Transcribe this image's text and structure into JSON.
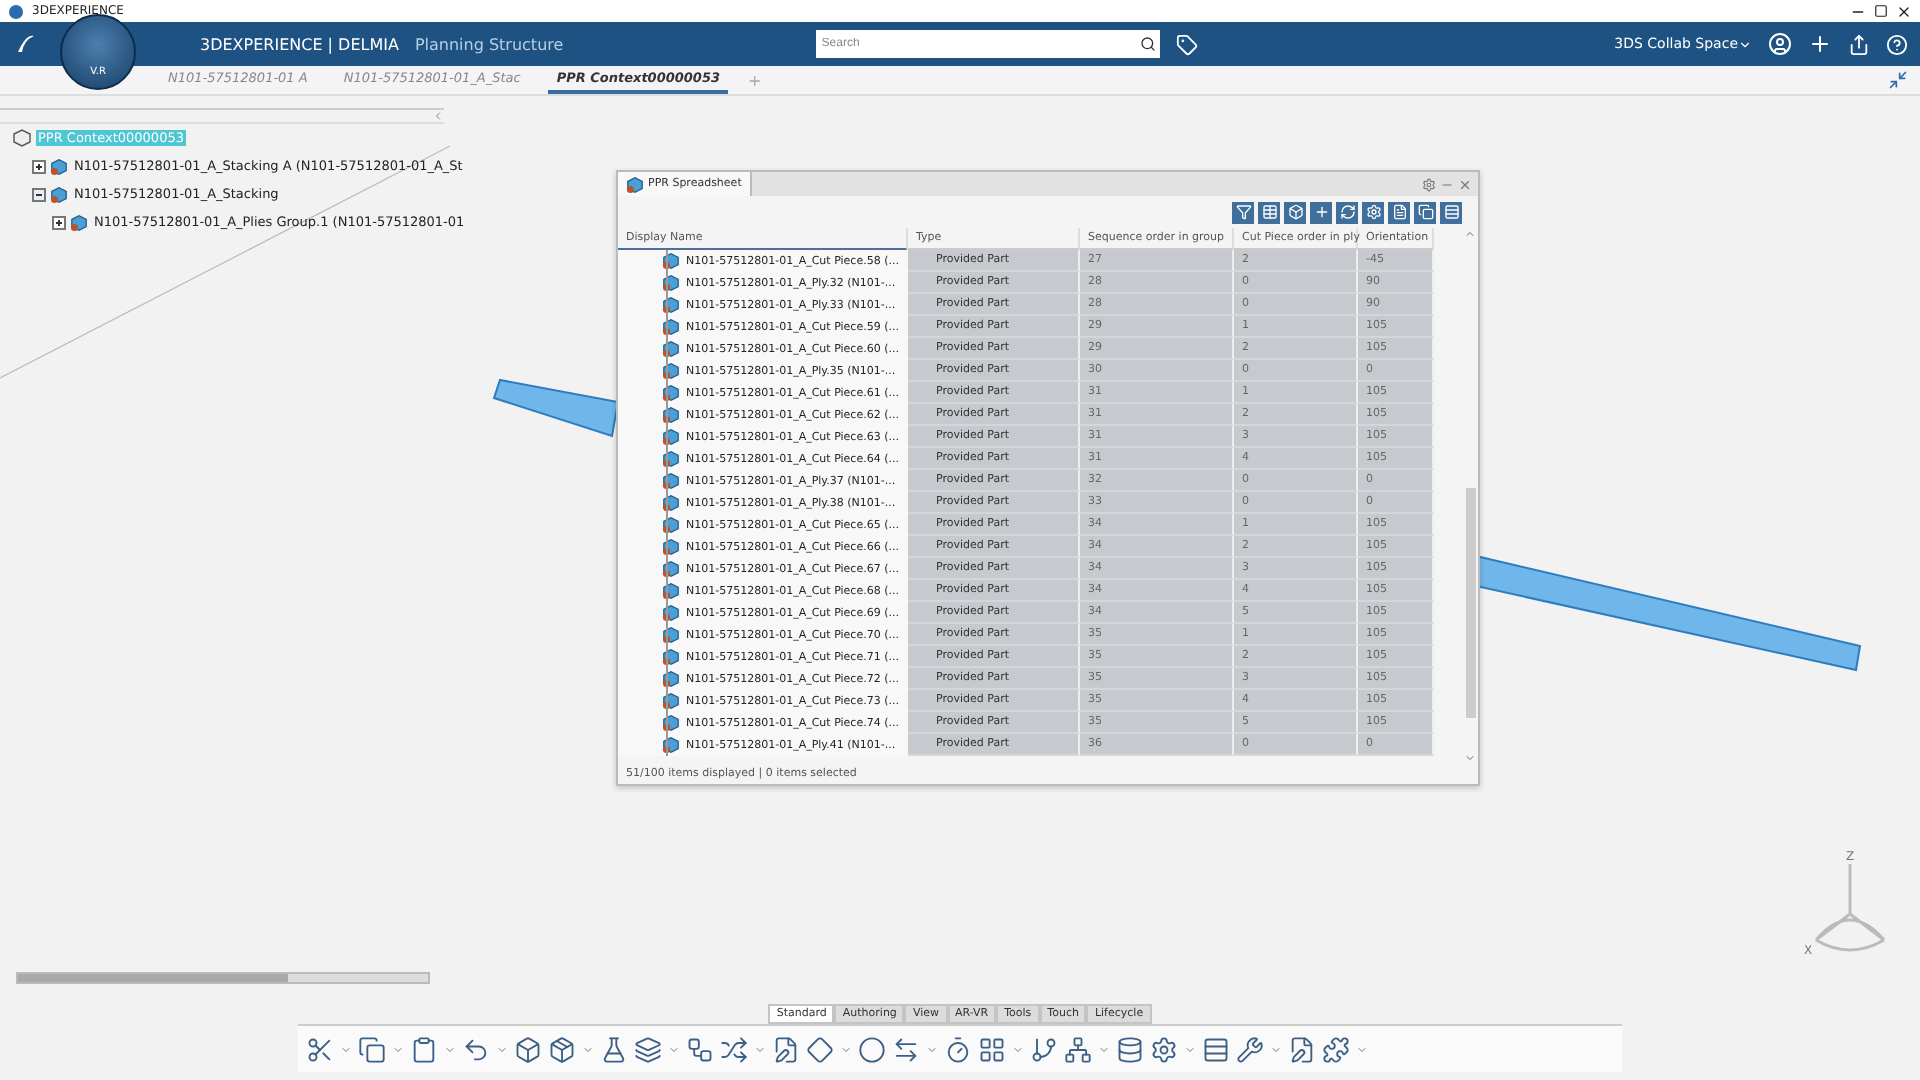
{
  "window": {
    "title": "3DEXPERIENCE"
  },
  "header": {
    "brand": "3DEXPERIENCE | DELMIA",
    "app": "Planning Structure",
    "compass_label": "V.R",
    "search": {
      "placeholder": "Search"
    },
    "space": "3DS Collab Space"
  },
  "doc_tabs": [
    {
      "label": "N101-57512801-01 A",
      "selected": false
    },
    {
      "label": "N101-57512801-01_A_Stac",
      "selected": false
    },
    {
      "label": "PPR Context00000053",
      "selected": true
    }
  ],
  "add_tab": "+",
  "tree": [
    {
      "label": "PPR Context00000053",
      "selected": true,
      "kind": "context",
      "children": [
        {
          "label": "N101-57512801-01_A_Stacking A (N101-57512801-01_A_St",
          "selected": false,
          "expanded": false,
          "kind": "part"
        },
        {
          "label": "N101-57512801-01_A_Stacking",
          "selected": false,
          "expanded": true,
          "kind": "part",
          "children": [
            {
              "label": "N101-57512801-01_A_Plies Group.1 (N101-57512801-01",
              "selected": false,
              "expanded": false,
              "kind": "part"
            }
          ]
        }
      ]
    }
  ],
  "spreadsheet": {
    "title": "PPR Spreadsheet",
    "columns": [
      "Display Name",
      "Type",
      "Sequence order in group",
      "Cut Piece order in ply",
      "Orientation"
    ],
    "rows": [
      [
        "N101-57512801-01_A_Cut Piece.58 (...",
        "Provided Part",
        "27",
        "2",
        "-45"
      ],
      [
        "N101-57512801-01_A_Ply.32 (N101-...",
        "Provided Part",
        "28",
        "0",
        "90"
      ],
      [
        "N101-57512801-01_A_Ply.33 (N101-...",
        "Provided Part",
        "28",
        "0",
        "90"
      ],
      [
        "N101-57512801-01_A_Cut Piece.59 (...",
        "Provided Part",
        "29",
        "1",
        "105"
      ],
      [
        "N101-57512801-01_A_Cut Piece.60 (...",
        "Provided Part",
        "29",
        "2",
        "105"
      ],
      [
        "N101-57512801-01_A_Ply.35 (N101-...",
        "Provided Part",
        "30",
        "0",
        "0"
      ],
      [
        "N101-57512801-01_A_Cut Piece.61 (...",
        "Provided Part",
        "31",
        "1",
        "105"
      ],
      [
        "N101-57512801-01_A_Cut Piece.62 (...",
        "Provided Part",
        "31",
        "2",
        "105"
      ],
      [
        "N101-57512801-01_A_Cut Piece.63 (...",
        "Provided Part",
        "31",
        "3",
        "105"
      ],
      [
        "N101-57512801-01_A_Cut Piece.64 (...",
        "Provided Part",
        "31",
        "4",
        "105"
      ],
      [
        "N101-57512801-01_A_Ply.37 (N101-...",
        "Provided Part",
        "32",
        "0",
        "0"
      ],
      [
        "N101-57512801-01_A_Ply.38 (N101-...",
        "Provided Part",
        "33",
        "0",
        "0"
      ],
      [
        "N101-57512801-01_A_Cut Piece.65 (...",
        "Provided Part",
        "34",
        "1",
        "105"
      ],
      [
        "N101-57512801-01_A_Cut Piece.66 (...",
        "Provided Part",
        "34",
        "2",
        "105"
      ],
      [
        "N101-57512801-01_A_Cut Piece.67 (...",
        "Provided Part",
        "34",
        "3",
        "105"
      ],
      [
        "N101-57512801-01_A_Cut Piece.68 (...",
        "Provided Part",
        "34",
        "4",
        "105"
      ],
      [
        "N101-57512801-01_A_Cut Piece.69 (...",
        "Provided Part",
        "34",
        "5",
        "105"
      ],
      [
        "N101-57512801-01_A_Cut Piece.70 (...",
        "Provided Part",
        "35",
        "1",
        "105"
      ],
      [
        "N101-57512801-01_A_Cut Piece.71 (...",
        "Provided Part",
        "35",
        "2",
        "105"
      ],
      [
        "N101-57512801-01_A_Cut Piece.72 (...",
        "Provided Part",
        "35",
        "3",
        "105"
      ],
      [
        "N101-57512801-01_A_Cut Piece.73 (...",
        "Provided Part",
        "35",
        "4",
        "105"
      ],
      [
        "N101-57512801-01_A_Cut Piece.74 (...",
        "Provided Part",
        "35",
        "5",
        "105"
      ],
      [
        "N101-57512801-01_A_Ply.41 (N101-...",
        "Provided Part",
        "36",
        "0",
        "0"
      ]
    ],
    "status": "51/100 items displayed | 0 items selected"
  },
  "compass": {
    "z": "Z",
    "x": "X"
  },
  "toolbar_tabs": [
    {
      "label": "Standard",
      "selected": true
    },
    {
      "label": "Authoring",
      "selected": false
    },
    {
      "label": "View",
      "selected": false
    },
    {
      "label": "AR-VR",
      "selected": false
    },
    {
      "label": "Tools",
      "selected": false
    },
    {
      "label": "Touch",
      "selected": false
    },
    {
      "label": "Lifecycle",
      "selected": false
    }
  ]
}
